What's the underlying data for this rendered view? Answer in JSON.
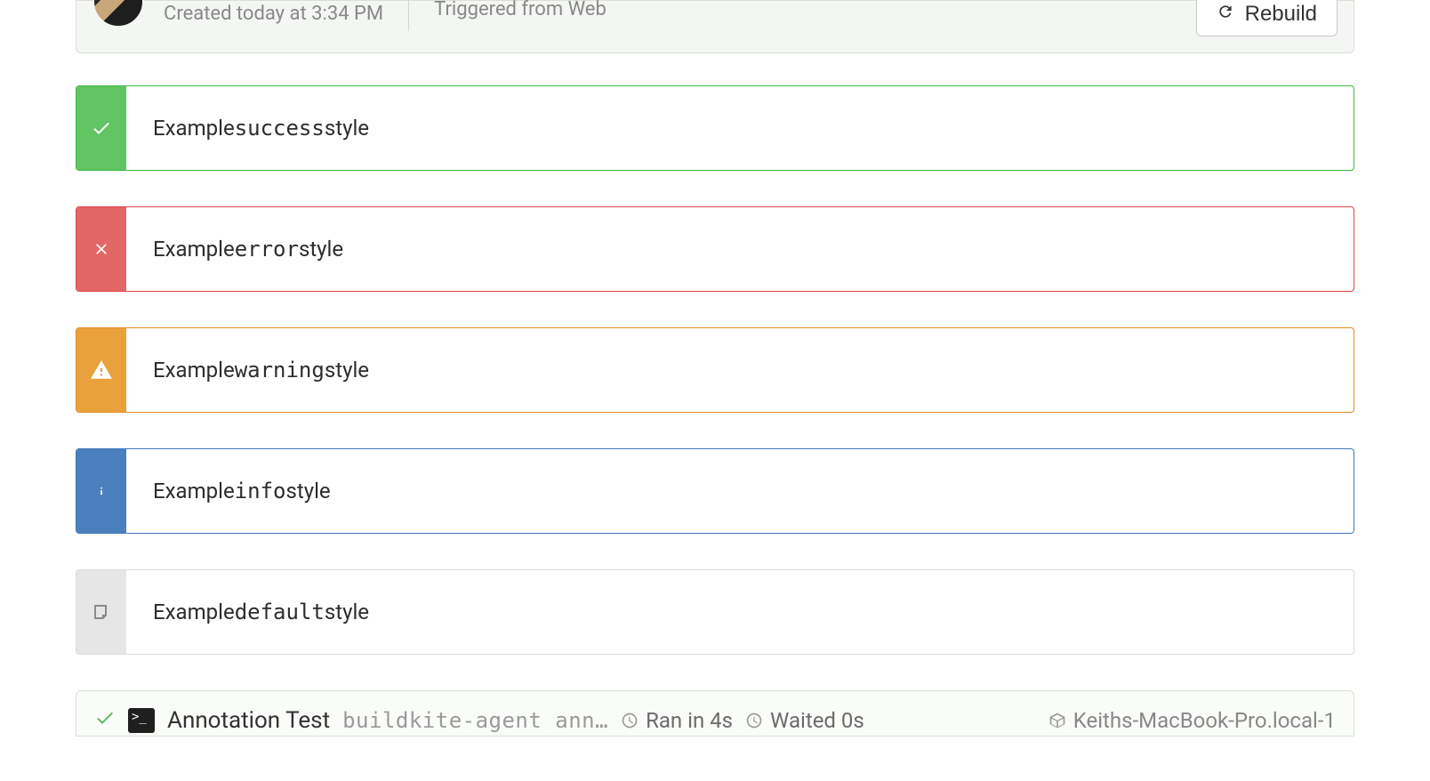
{
  "header": {
    "created_line": "Created today at 3:34 PM",
    "trigger_line": "Triggered from Web",
    "rebuild_label": "Rebuild"
  },
  "annotations": [
    {
      "style": "success",
      "text_before": "Example ",
      "keyword": "success",
      "text_after": " style"
    },
    {
      "style": "error",
      "text_before": "Example ",
      "keyword": "error",
      "text_after": " style"
    },
    {
      "style": "warning",
      "text_before": "Example ",
      "keyword": "warning",
      "text_after": " style"
    },
    {
      "style": "info",
      "text_before": "Example ",
      "keyword": "info",
      "text_after": " style"
    },
    {
      "style": "default",
      "text_before": "Example ",
      "keyword": "default",
      "text_after": " style"
    }
  ],
  "job": {
    "title": "Annotation Test",
    "command": "buildkite-agent ann…",
    "ran_in": "Ran in 4s",
    "waited": "Waited 0s",
    "agent": "Keiths-MacBook-Pro.local-1"
  }
}
